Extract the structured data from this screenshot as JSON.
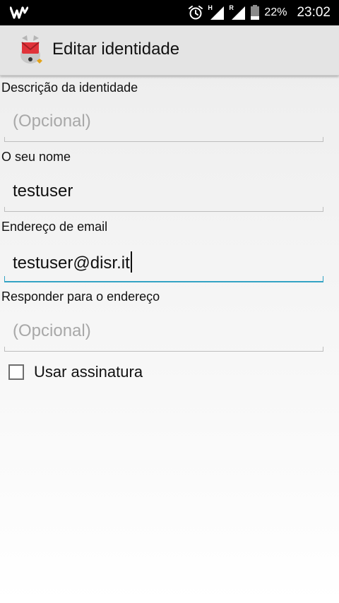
{
  "status_bar": {
    "app_icon": "w-logo-icon",
    "alarm_icon": "alarm-icon",
    "signal_1_label": "H",
    "signal_2_label": "R",
    "battery_percent": "22%",
    "time": "23:02"
  },
  "app_bar": {
    "title": "Editar identidade",
    "logo_icon": "k9-mail-logo-icon"
  },
  "form": {
    "description": {
      "label": "Descrição da identidade",
      "value": "",
      "placeholder": "(Opcional)"
    },
    "name": {
      "label": "O seu nome",
      "value": "testuser",
      "placeholder": ""
    },
    "email": {
      "label": "Endereço de email",
      "value": "testuser@disr.it",
      "placeholder": ""
    },
    "reply_to": {
      "label": "Responder para o endereço",
      "value": "",
      "placeholder": "(Opcional)"
    },
    "signature": {
      "label": "Usar assinatura",
      "checked": false
    }
  },
  "colors": {
    "accent": "#33a3c4",
    "status_bar_bg": "#000000",
    "app_bar_bg": "#e4e4e4",
    "placeholder_text": "#a8a8a8"
  }
}
